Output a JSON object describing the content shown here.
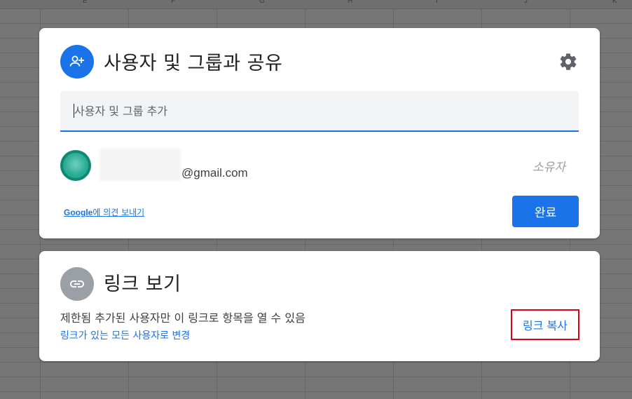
{
  "background": {
    "column_letters": [
      "E",
      "F",
      "G",
      "H",
      "I",
      "J",
      "K"
    ]
  },
  "share_dialog": {
    "title": "사용자 및 그룹과 공유",
    "title_icon": "person-add-icon",
    "settings_icon": "gear-icon",
    "add_field": {
      "placeholder": "사용자 및 그룹 추가",
      "value": ""
    },
    "people": [
      {
        "email_domain": "@gmail.com",
        "role": "소유자"
      }
    ],
    "feedback": {
      "brand": "Google",
      "text": "에 의견 보내기"
    },
    "done_label": "완료",
    "accent_color": "#1a73e8"
  },
  "link_dialog": {
    "title": "링크 보기",
    "title_icon": "link-icon",
    "description": "제한됨 추가된 사용자만 이 링크로 항목을 열 수 있음",
    "change_link_label": "링크가 있는 모든 사용자로 변경",
    "copy_link_label": "링크 복사",
    "highlight_color": "#e0000f"
  }
}
